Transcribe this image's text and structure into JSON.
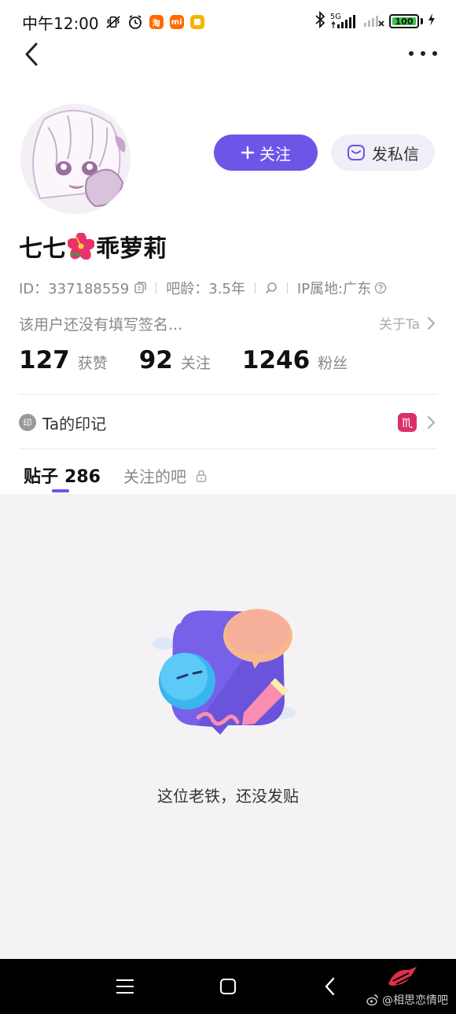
{
  "status_bar": {
    "time": "中午12:00",
    "app_badges": [
      {
        "name": "taobao-icon",
        "label": "淘",
        "color": "#ff6a00"
      },
      {
        "name": "mi-icon",
        "label": "mi",
        "color": "#ff6900"
      },
      {
        "name": "notes-icon",
        "label": "",
        "color": "#f5b400"
      }
    ],
    "network": "5G",
    "battery": "100"
  },
  "profile": {
    "name_part1": "七七",
    "name_emoji": "hibiscus-icon",
    "name_part2": "乖萝莉",
    "id_text": "ID：337188559",
    "age_text": "吧龄：3.5年",
    "ip_text": "IP属地:广东",
    "signature": "该用户还没有填写签名...",
    "about_label": "关于Ta"
  },
  "actions": {
    "follow_label": "关注",
    "dm_label": "发私信"
  },
  "stats": [
    {
      "value": "127",
      "label": "获赞"
    },
    {
      "value": "92",
      "label": "关注"
    },
    {
      "value": "1246",
      "label": "粉丝"
    }
  ],
  "mark": {
    "badge": "印",
    "label": "Ta的印记",
    "zodiac": "♏"
  },
  "tabs": {
    "posts_label": "贴子",
    "posts_count": "286",
    "forums_label": "关注的吧"
  },
  "empty_state": {
    "text": "这位老铁，还没发贴"
  },
  "watermark": {
    "text": "@相思恋情吧"
  },
  "colors": {
    "accent": "#6e55e8",
    "content_bg": "#f5f2f6"
  }
}
